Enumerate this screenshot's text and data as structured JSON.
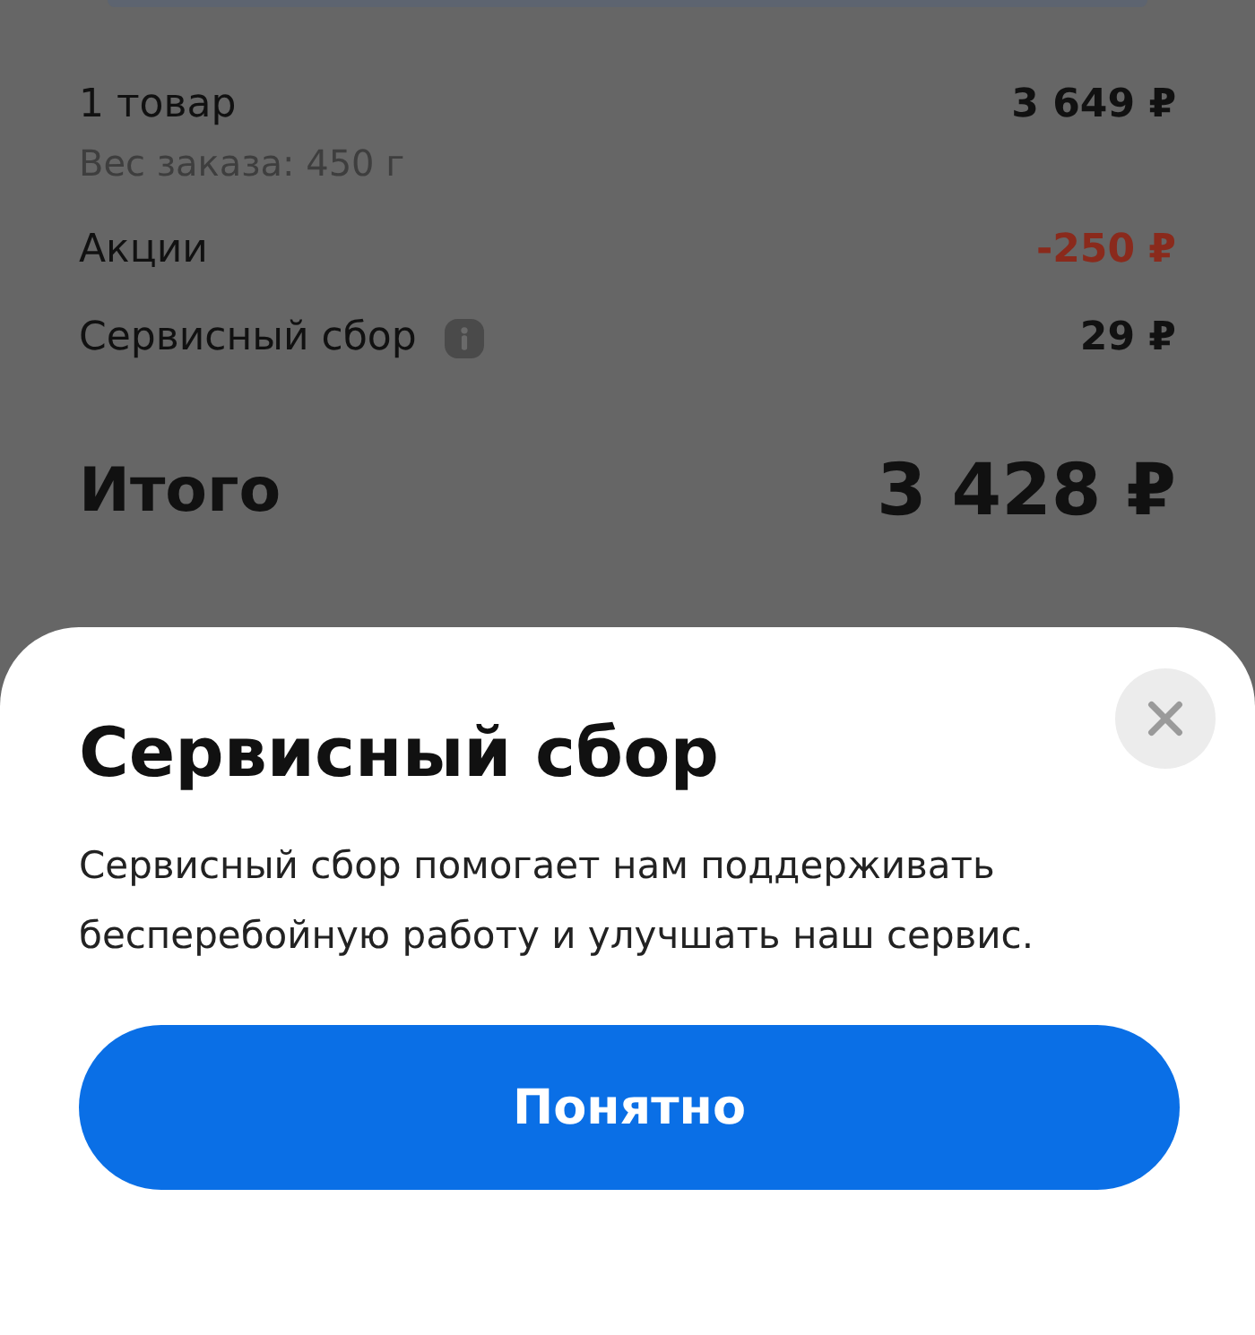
{
  "summary": {
    "lines": [
      {
        "label": "1 товар",
        "sublabel": "Вес заказа: 450 г",
        "amount": "3 649 ₽",
        "kind": "regular",
        "info": false
      },
      {
        "label": "Акции",
        "amount": "-250 ₽",
        "kind": "discount",
        "info": false
      },
      {
        "label": "Сервисный сбор",
        "amount": "29 ₽",
        "kind": "regular",
        "info": true
      }
    ],
    "total": {
      "label": "Итого",
      "amount": "3 428 ₽"
    }
  },
  "sheet": {
    "title": "Сервисный сбор",
    "text": "Сервисный сбор помогает нам поддерживать бесперебойную работу и улучшать наш сервис.",
    "button": "Понятно"
  }
}
